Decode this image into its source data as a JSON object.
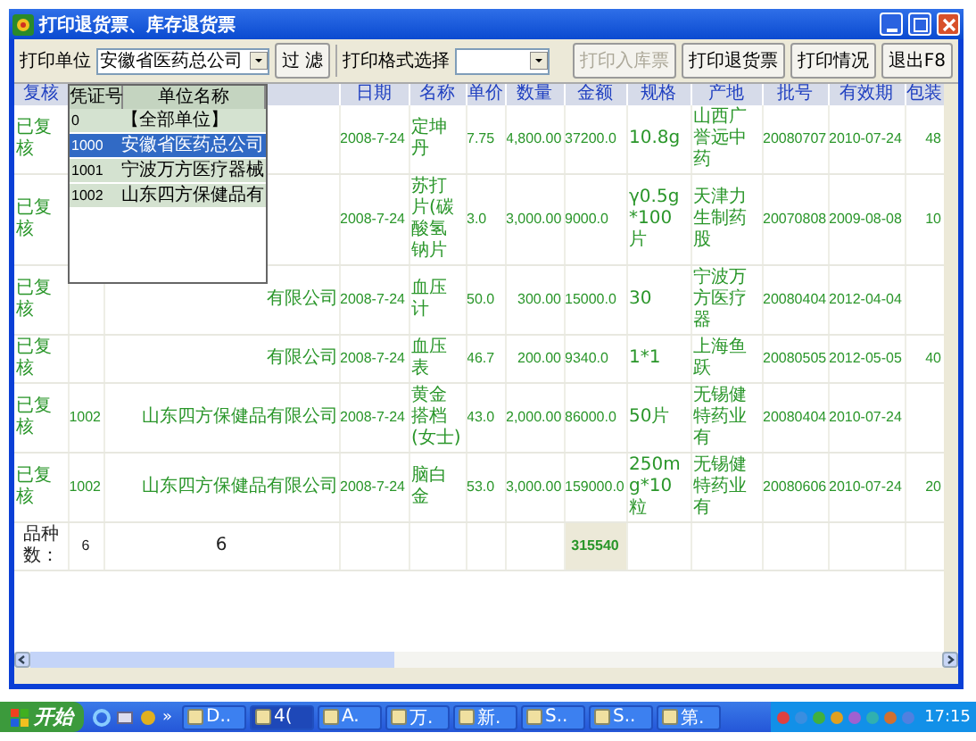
{
  "window": {
    "title": "打印退货票、库存退货票"
  },
  "toolbar": {
    "unit_label": "打印单位",
    "unit_value": "安徽省医药总公司",
    "filter_button": "过 滤",
    "format_label": "打印格式选择",
    "buttons": [
      {
        "label": "打印入库票",
        "disabled": true
      },
      {
        "label": "打印退货票",
        "disabled": false
      },
      {
        "label": "打印情况",
        "disabled": false
      },
      {
        "label": "退出F8",
        "disabled": false
      }
    ]
  },
  "unit_dropdown": {
    "columns": [
      "凭证号",
      "单位名称"
    ],
    "rows": [
      {
        "code": "0",
        "name": "【全部单位】",
        "selected": false
      },
      {
        "code": "1000",
        "name": "安徽省医药总公司",
        "selected": true
      },
      {
        "code": "1001",
        "name": "宁波万方医疗器械",
        "selected": false
      },
      {
        "code": "1002",
        "name": "山东四方保健品有",
        "selected": false
      }
    ]
  },
  "table": {
    "columns": [
      "复核",
      null,
      null,
      "日期",
      "名称",
      "单价",
      "数量",
      "金额",
      "规格",
      "产地",
      "批号",
      "有效期",
      "包装"
    ],
    "rows": [
      [
        "已复核",
        null,
        null,
        "2008-7-24",
        "定坤丹",
        "7.75",
        "4,800.00",
        "37200.0",
        "10.8g",
        "山西广誉远中药",
        "20080707",
        "2010-07-24",
        "48"
      ],
      [
        "已复核",
        null,
        null,
        "2008-7-24",
        "苏打片(碳酸氢钠片",
        "3.0",
        "3,000.00",
        "9000.0",
        "γ0.5g*100片",
        "天津力生制药股",
        "20070808",
        "2009-08-08",
        "10"
      ],
      [
        "已复核",
        null,
        "有限公司",
        "2008-7-24",
        "血压计",
        "50.0",
        "300.00",
        "15000.0",
        "30",
        "宁波万方医疗器",
        "20080404",
        "2012-04-04",
        null
      ],
      [
        "已复核",
        null,
        "有限公司",
        "2008-7-24",
        "血压表",
        "46.7",
        "200.00",
        "9340.0",
        "1*1",
        "上海鱼跃",
        "20080505",
        "2012-05-05",
        "40"
      ],
      [
        "已复核",
        "1002",
        "山东四方保健品有限公司",
        "2008-7-24",
        "黄金搭档(女士)",
        "43.0",
        "2,000.00",
        "86000.0",
        "50片",
        "无锡健特药业有",
        "20080404",
        "2010-07-24",
        null
      ],
      [
        "已复核",
        "1002",
        "山东四方保健品有限公司",
        "2008-7-24",
        "脑白金",
        "53.0",
        "3,000.00",
        "159000.0",
        "250mg*10粒",
        "无锡健特药业有",
        "20080606",
        "2010-07-24",
        "20"
      ]
    ],
    "footer": {
      "label": "品种数：",
      "counts": [
        "6",
        "6"
      ],
      "total": "315540"
    }
  },
  "taskbar": {
    "start": "开始",
    "more": "»",
    "tasks": [
      {
        "label": "D..",
        "active": false
      },
      {
        "label": "4(",
        "active": true
      },
      {
        "label": "A.",
        "active": false
      },
      {
        "label": "万.",
        "active": false
      },
      {
        "label": "新.",
        "active": false
      },
      {
        "label": "S..",
        "active": false
      },
      {
        "label": "S..",
        "active": false
      },
      {
        "label": "第.",
        "active": false
      }
    ],
    "clock": "17:15"
  }
}
